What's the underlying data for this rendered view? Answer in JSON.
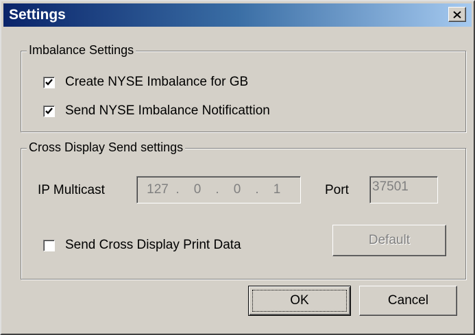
{
  "window": {
    "title": "Settings",
    "close_icon": "close-x-icon"
  },
  "imbalance": {
    "group_label": "Imbalance Settings",
    "create_label": "Create NYSE Imbalance for GB",
    "create_checked": true,
    "notify_label": "Send NYSE Imbalance Notificattion",
    "notify_checked": true
  },
  "cross": {
    "group_label": "Cross Display Send settings",
    "ip_label": "IP Multicast",
    "ip_octets": [
      "127",
      "0",
      "0",
      "1"
    ],
    "ip_dot": ".",
    "port_label": "Port",
    "port_value": "37501",
    "print_label": "Send Cross Display Print Data",
    "print_checked": false,
    "default_label": "Default"
  },
  "buttons": {
    "ok_label": "OK",
    "cancel_label": "Cancel"
  }
}
